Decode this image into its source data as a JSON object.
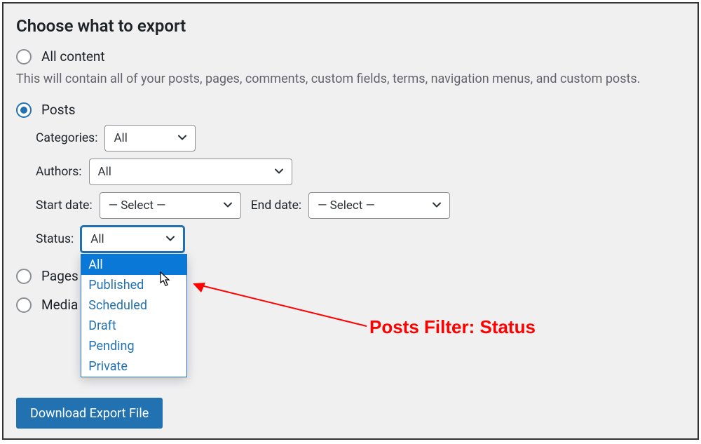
{
  "title": "Choose what to export",
  "radios": {
    "all_content": "All content",
    "posts": "Posts",
    "pages": "Pages",
    "media": "Media"
  },
  "description": "This will contain all of your posts, pages, comments, custom fields, terms, navigation menus, and custom posts.",
  "filters": {
    "categories_label": "Categories:",
    "categories_value": "All",
    "authors_label": "Authors:",
    "authors_value": "All",
    "start_date_label": "Start date:",
    "start_date_value": "— Select —",
    "end_date_label": "End date:",
    "end_date_value": "— Select —",
    "status_label": "Status:",
    "status_value": "All",
    "status_options": {
      "o0": "All",
      "o1": "Published",
      "o2": "Scheduled",
      "o3": "Draft",
      "o4": "Pending",
      "o5": "Private"
    }
  },
  "button": "Download Export File",
  "annotation": "Posts Filter: Status"
}
